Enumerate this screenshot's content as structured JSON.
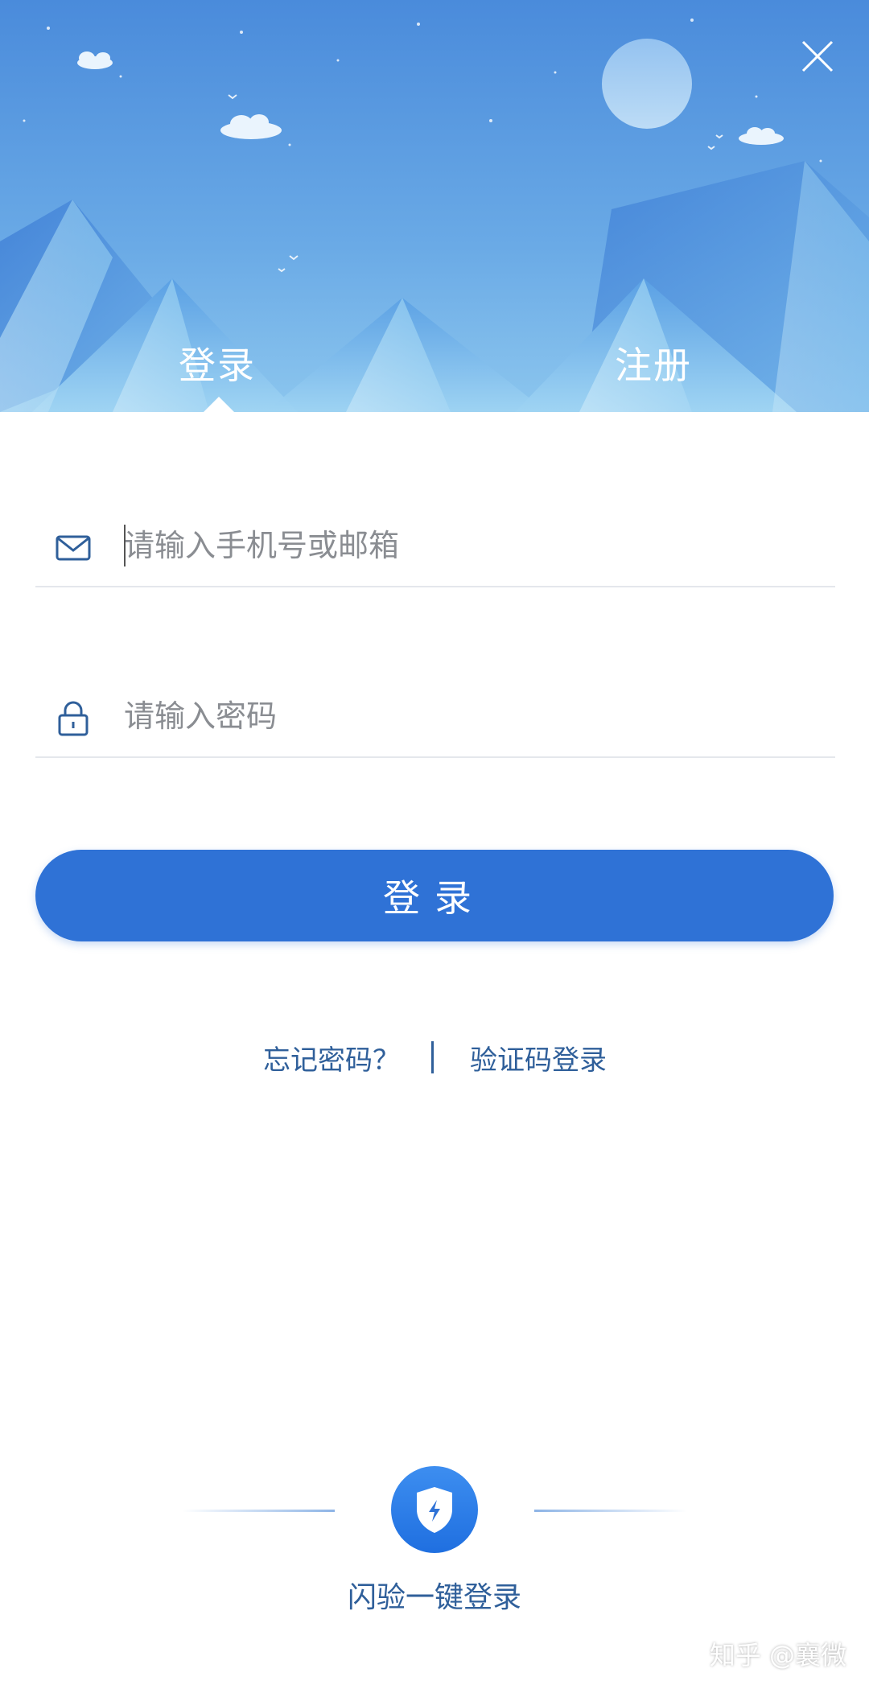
{
  "header": {
    "tabs": [
      {
        "label": "登录",
        "active": true
      },
      {
        "label": "注册",
        "active": false
      }
    ],
    "close_icon": "close-icon"
  },
  "form": {
    "account": {
      "placeholder": "请输入手机号或邮箱",
      "value": "",
      "icon": "mail-icon"
    },
    "password": {
      "placeholder": "请输入密码",
      "value": "",
      "icon": "lock-icon"
    },
    "submit_label": "登录"
  },
  "links": {
    "forgot_password": "忘记密码？",
    "sms_login": "验证码登录"
  },
  "flash_login": {
    "label": "闪验一键登录",
    "icon": "shield-bolt-icon"
  },
  "watermark": "知乎 @襄微",
  "colors": {
    "primary": "#2f72d6",
    "sky_top": "#4b8ede",
    "link": "#2f5f9a"
  }
}
